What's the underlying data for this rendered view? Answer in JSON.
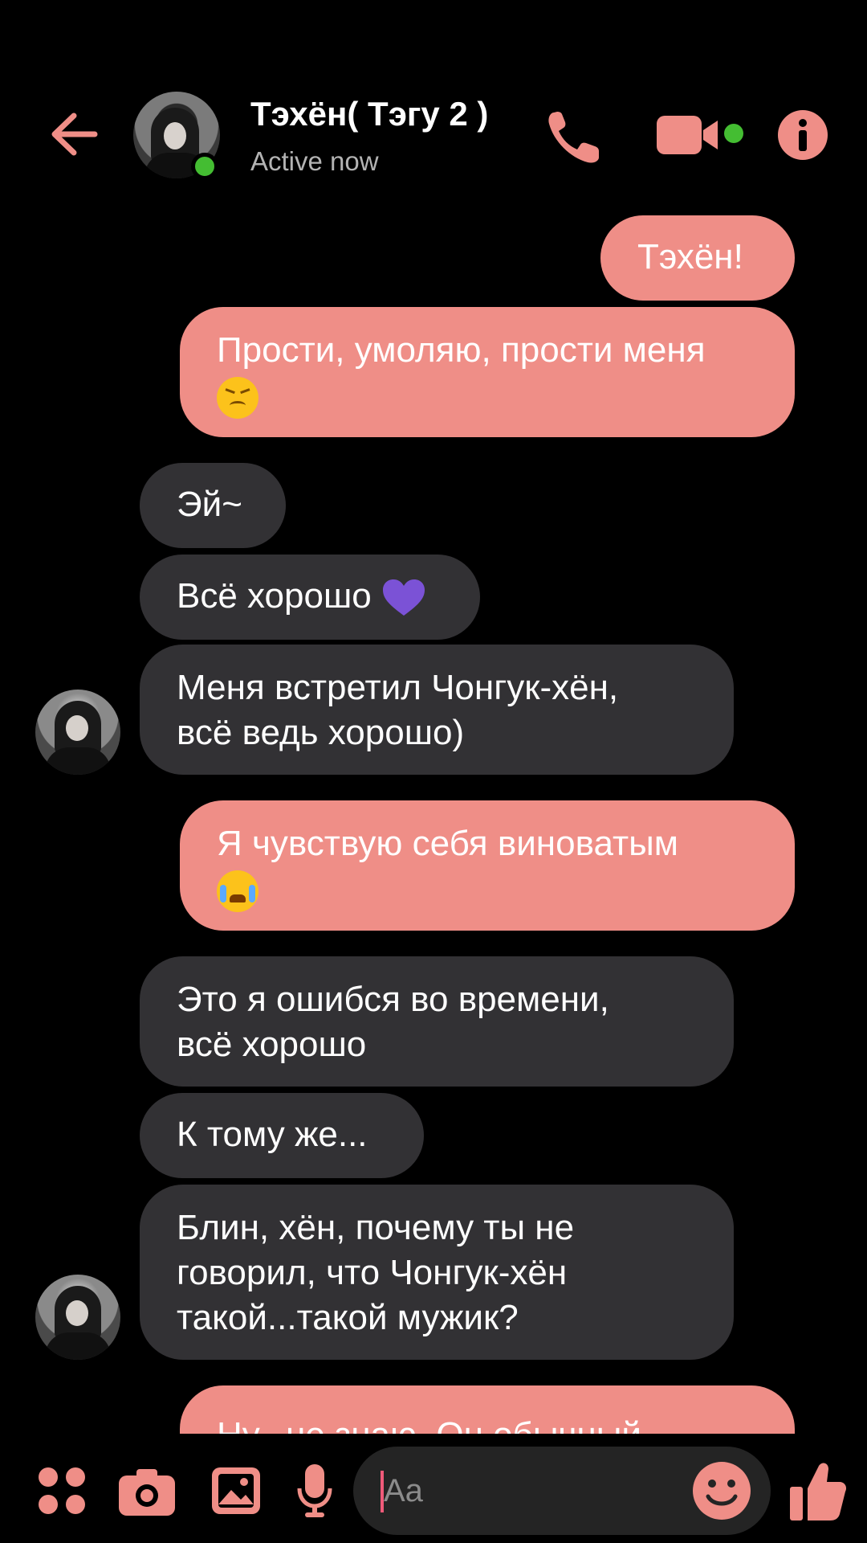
{
  "header": {
    "contact_name": "Тэхён( Тэгу 2 )",
    "status": "Active now",
    "accent_color": "#ef8e87",
    "online_color": "#44bd32"
  },
  "messages": [
    {
      "side": "out",
      "text": "Тэхён!"
    },
    {
      "side": "out",
      "text": "Прости, умоляю, прости меня",
      "emoji": "persevering-face"
    },
    {
      "side": "in",
      "text": "Эй~"
    },
    {
      "side": "in",
      "text": "Всё хорошо",
      "emoji": "purple-heart"
    },
    {
      "side": "in",
      "text": "Меня встретил Чонгук-хён, всё ведь хорошо)"
    },
    {
      "side": "out",
      "text": "Я чувствую себя виноватым",
      "emoji": "loudly-crying-face"
    },
    {
      "side": "in",
      "text": "Это я ошибся во времени, всё хорошо"
    },
    {
      "side": "in",
      "text": "К тому же..."
    },
    {
      "side": "in",
      "text": "Блин, хён, почему ты не говорил, что Чонгук-хён такой...такой мужик?"
    },
    {
      "side": "out",
      "text": "Ну...не знаю. Он обычный"
    }
  ],
  "composer": {
    "placeholder": "Aa",
    "icons": [
      "apps-icon",
      "camera-icon",
      "gallery-icon",
      "microphone-icon",
      "emoji-icon",
      "thumbs-up-icon"
    ]
  }
}
